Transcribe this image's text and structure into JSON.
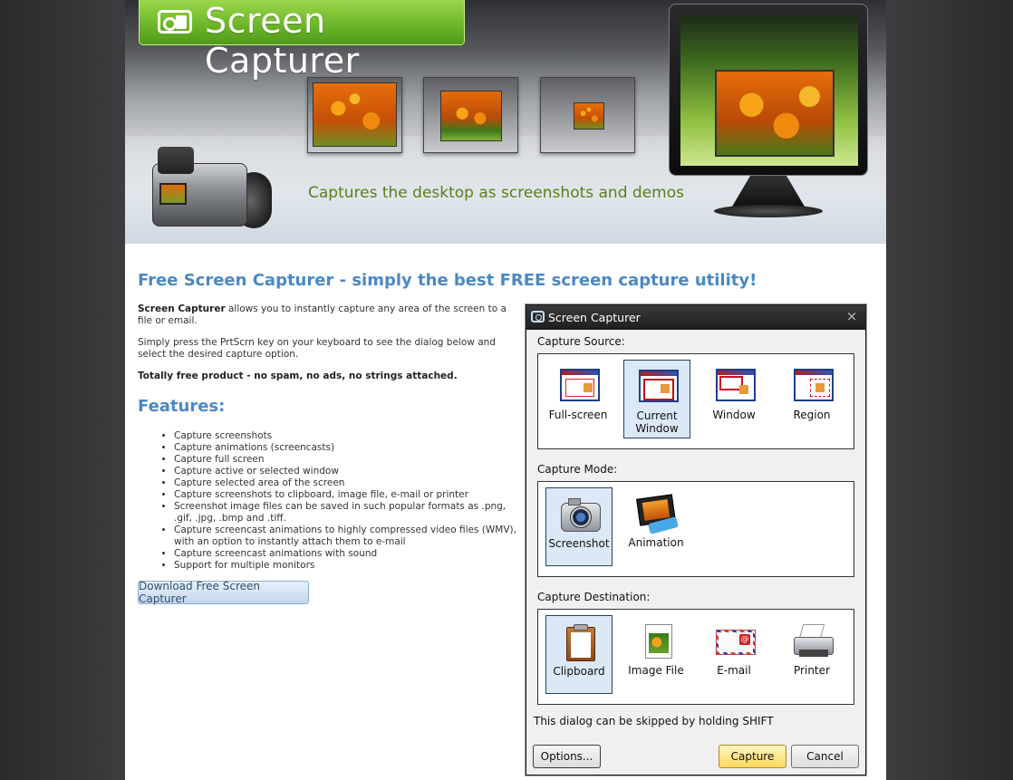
{
  "banner": {
    "logo_text": "Screen Capturer",
    "tagline": "Captures the desktop as screenshots and demos"
  },
  "content": {
    "heading": "Free Screen Capturer - simply the best FREE screen capture utility!",
    "intro_bold": "Screen Capturer",
    "intro_rest": " allows you to instantly capture any area of the screen to a file or email.",
    "intro2": "Simply press the PrtScrn key on your keyboard to see the dialog below and select the desired capture option.",
    "intro3": "Totally free product - no spam, no ads, no strings attached.",
    "features_heading": "Features:",
    "features": [
      "Capture screenshots",
      "Capture animations (screencasts)",
      "Capture full screen",
      "Capture active or selected window",
      "Capture selected area of the screen",
      "Capture screenshots to clipboard, image file, e-mail or printer",
      "Screenshot image files can be saved in such popular formats as .png, .gif, .jpg, .bmp and .tiff.",
      "Capture screencast animations to highly compressed video files (WMV), with an option to instantly attach them to e-mail",
      "Capture screencast animations with sound",
      "Support for multiple monitors"
    ],
    "download_button": "Download Free Screen Capturer"
  },
  "dialog": {
    "title": "Screen Capturer",
    "close": "×",
    "source_label": "Capture Source:",
    "source_options": [
      {
        "label": "Full-screen",
        "icon": "full-screen-icon"
      },
      {
        "label": "Current Window",
        "icon": "current-window-icon"
      },
      {
        "label": "Window",
        "icon": "window-icon"
      },
      {
        "label": "Region",
        "icon": "region-icon"
      }
    ],
    "source_selected": "Current Window",
    "mode_label": "Capture Mode:",
    "mode_options": [
      {
        "label": "Screenshot",
        "icon": "camera-icon"
      },
      {
        "label": "Animation",
        "icon": "film-icon"
      }
    ],
    "mode_selected": "Screenshot",
    "dest_label": "Capture Destination:",
    "dest_options": [
      {
        "label": "Clipboard",
        "icon": "clipboard-icon"
      },
      {
        "label": "Image File",
        "icon": "image-file-icon"
      },
      {
        "label": "E-mail",
        "icon": "email-icon"
      },
      {
        "label": "Printer",
        "icon": "printer-icon"
      }
    ],
    "dest_selected": "Clipboard",
    "note": "This dialog can be skipped by holding SHIFT",
    "options_button": "Options...",
    "capture_button": "Capture",
    "cancel_button": "Cancel"
  },
  "colors": {
    "accent_blue": "#4a88c5",
    "logo_green": "#6fb72b",
    "tagline_green": "#5a7f1a",
    "capture_button": "#fbd85a"
  }
}
